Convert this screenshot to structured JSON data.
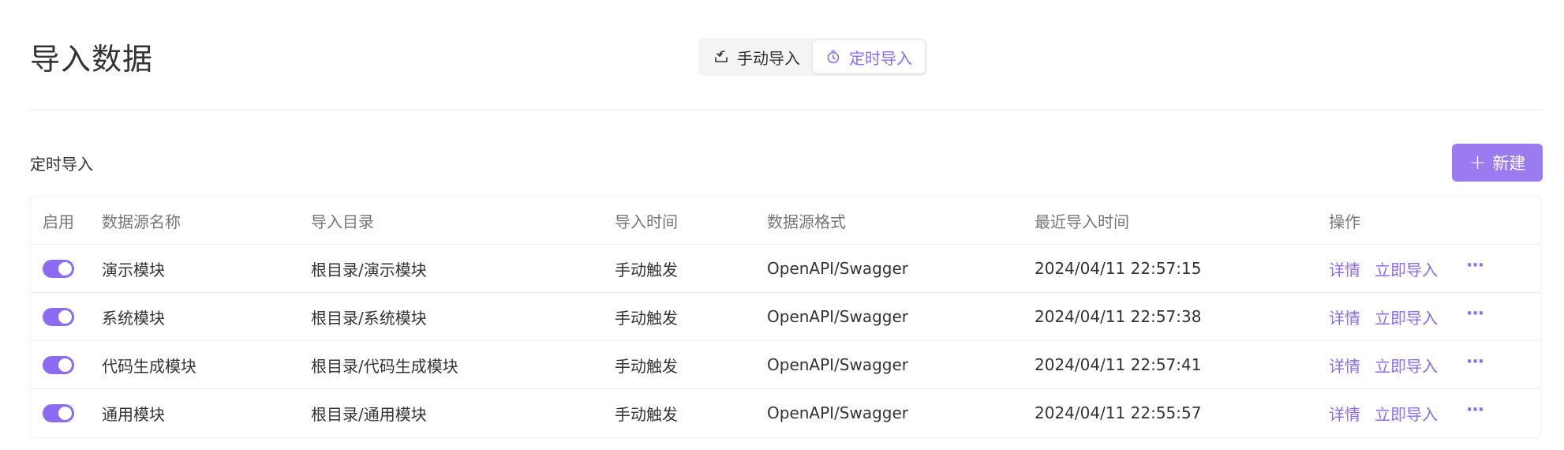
{
  "header": {
    "title": "导入数据",
    "tabs": [
      {
        "label": "手动导入",
        "icon": "import-icon",
        "active": false
      },
      {
        "label": "定时导入",
        "icon": "timer-icon",
        "active": true
      }
    ]
  },
  "section": {
    "label": "定时导入",
    "new_button": {
      "icon": "plus-icon",
      "label": "新建"
    }
  },
  "colors": {
    "accent": "#8b6cf0",
    "button": "#9b7bf0"
  },
  "table": {
    "columns": {
      "enable": "启用",
      "name": "数据源名称",
      "dir": "导入目录",
      "time": "导入时间",
      "format": "数据源格式",
      "recent": "最近导入时间",
      "ops": "操作"
    },
    "actions": {
      "detail": "详情",
      "import_now": "立即导入",
      "more": "···"
    },
    "rows": [
      {
        "enabled": true,
        "name": "演示模块",
        "dir": "根目录/演示模块",
        "time": "手动触发",
        "format": "OpenAPI/Swagger",
        "recent": "2024/04/11 22:57:15"
      },
      {
        "enabled": true,
        "name": "系统模块",
        "dir": "根目录/系统模块",
        "time": "手动触发",
        "format": "OpenAPI/Swagger",
        "recent": "2024/04/11 22:57:38"
      },
      {
        "enabled": true,
        "name": "代码生成模块",
        "dir": "根目录/代码生成模块",
        "time": "手动触发",
        "format": "OpenAPI/Swagger",
        "recent": "2024/04/11 22:57:41"
      },
      {
        "enabled": true,
        "name": "通用模块",
        "dir": "根目录/通用模块",
        "time": "手动触发",
        "format": "OpenAPI/Swagger",
        "recent": "2024/04/11 22:55:57"
      }
    ]
  }
}
